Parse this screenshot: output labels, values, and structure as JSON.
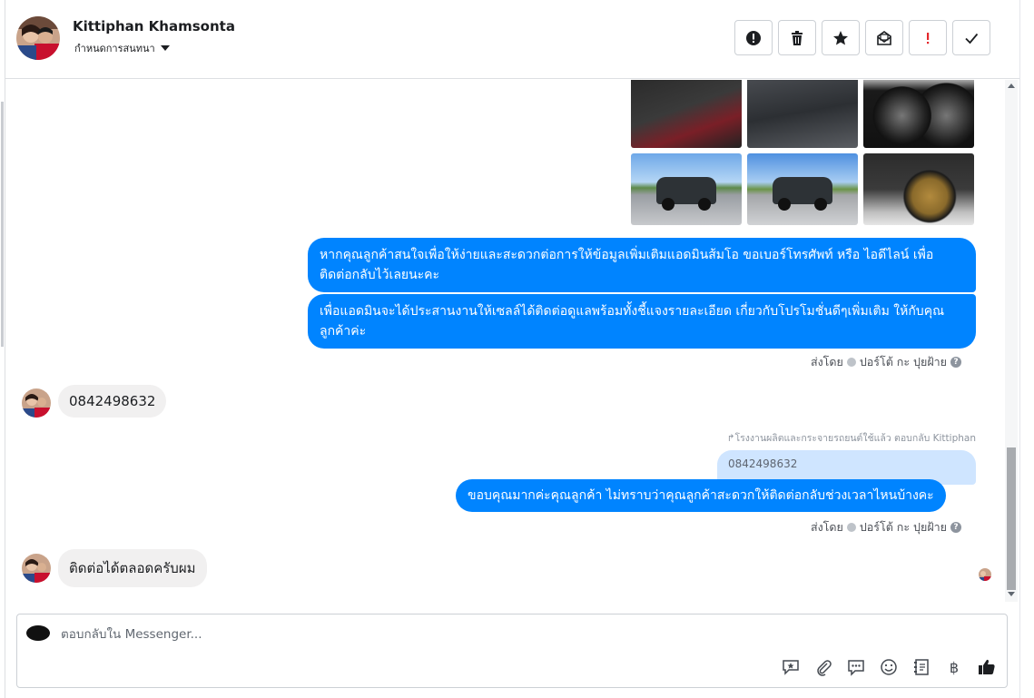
{
  "header": {
    "name": "Kittiphan Khamsonta",
    "subtitle": "กำหนดการสนทนา"
  },
  "toolbar": {
    "buttons": [
      "alert-icon",
      "trash-icon",
      "star-icon",
      "mark-unread-icon",
      "spam-icon",
      "check-icon"
    ]
  },
  "messages": {
    "outgoing_1": "หากคุณลูกค้าสนใจเพื่อให้ง่ายและสะดวกต่อการให้ข้อมูลเพิ่มเติมแอดมินส้มโอ ขอเบอร์โทรศัพท์ หรือ ไอดีไลน์ เพื่อติดต่อกลับไว้เลยนะคะ",
    "outgoing_2": "เพื่อแอดมินจะได้ประสานงานให้เซลล์ได้ติดต่อดูแลพร้อมทั้งชี้แจงรายละเอียด เกี่ยวกับโปรโมชั่นดีๆเพิ่มเติม ให้กับคุณลูกค้าค่ะ",
    "sent_by_label": "ส่งโดย",
    "sent_by_name": "ปอร์โต้ กะ ปุยฝ้าย",
    "incoming_1": "0842498632",
    "reply_note": "โรงงานผลิตและกระจายรถยนต์ใช้แล้ว ตอบกลับ Kittiphan",
    "quoted_text": "0842498632",
    "outgoing_3": "ขอบคุณมากค่ะคุณลูกค้า ไม่ทราบว่าคุณลูกค้าสะดวกให้ติดต่อกลับช่วงเวลาไหนบ้างคะ",
    "incoming_2": "ติดต่อได้ตลอดครับผม"
  },
  "composer": {
    "placeholder": "ตอบกลับใน Messenger...",
    "tools": [
      "sticker-icon",
      "attachment-icon",
      "saved-reply-icon",
      "emoji-icon",
      "appointment-icon",
      "payment-icon",
      "like-icon"
    ],
    "payment_symbol": "฿"
  },
  "colors": {
    "accent": "#0084ff",
    "incoming_bubble": "#f1f0f0",
    "quoted_bubble": "#cfe5ff"
  }
}
